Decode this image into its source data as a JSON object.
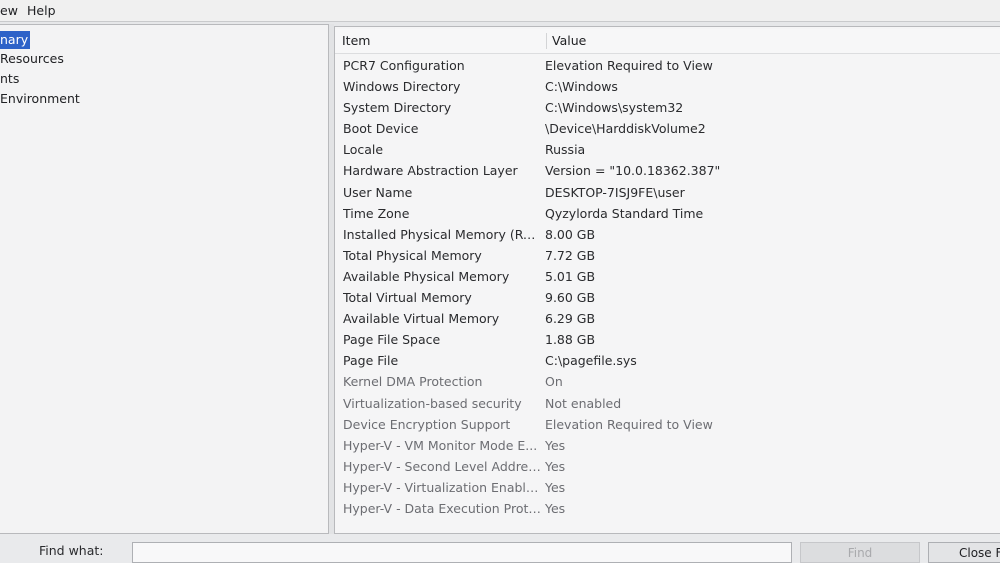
{
  "menu": {
    "view_label": "ew",
    "help_label": "Help"
  },
  "tree": {
    "items": [
      {
        "label": "nary",
        "selected": true
      },
      {
        "label": " Resources"
      },
      {
        "label": "nts"
      },
      {
        "label": "Environment"
      }
    ]
  },
  "list": {
    "columns": {
      "item": "Item",
      "value": "Value"
    },
    "rows": [
      {
        "item": "PCR7 Configuration",
        "value": "Elevation Required to View"
      },
      {
        "item": "Windows Directory",
        "value": "C:\\Windows"
      },
      {
        "item": "System Directory",
        "value": "C:\\Windows\\system32"
      },
      {
        "item": "Boot Device",
        "value": "\\Device\\HarddiskVolume2"
      },
      {
        "item": "Locale",
        "value": "Russia"
      },
      {
        "item": "Hardware Abstraction Layer",
        "value": "Version = \"10.0.18362.387\""
      },
      {
        "item": "User Name",
        "value": "DESKTOP-7ISJ9FE\\user"
      },
      {
        "item": "Time Zone",
        "value": "Qyzylorda Standard Time"
      },
      {
        "item": "Installed Physical Memory (RAM)",
        "value": "8.00 GB"
      },
      {
        "item": "Total Physical Memory",
        "value": "7.72 GB"
      },
      {
        "item": "Available Physical Memory",
        "value": "5.01 GB"
      },
      {
        "item": "Total Virtual Memory",
        "value": "9.60 GB"
      },
      {
        "item": "Available Virtual Memory",
        "value": "6.29 GB"
      },
      {
        "item": "Page File Space",
        "value": "1.88 GB"
      },
      {
        "item": "Page File",
        "value": "C:\\pagefile.sys"
      },
      {
        "item": "Kernel DMA Protection",
        "value": "On"
      },
      {
        "item": "Virtualization-based security",
        "value": "Not enabled"
      },
      {
        "item": "Device Encryption Support",
        "value": "Elevation Required to View"
      },
      {
        "item": "Hyper-V - VM Monitor Mode E...",
        "value": "Yes"
      },
      {
        "item": "Hyper-V - Second Level Addres...",
        "value": "Yes"
      },
      {
        "item": "Hyper-V - Virtualization Enable...",
        "value": "Yes"
      },
      {
        "item": "Hyper-V - Data Execution Prote...",
        "value": "Yes"
      }
    ]
  },
  "find": {
    "label": "Find what:",
    "value": "",
    "find_button_label": "Find",
    "close_button_label": "Close Fi"
  }
}
